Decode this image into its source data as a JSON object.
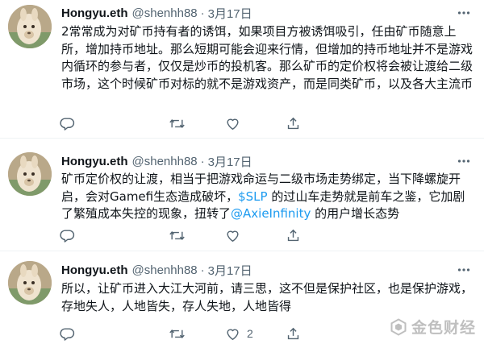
{
  "colors": {
    "accent": "#1d9bf0",
    "muted": "#536471",
    "text": "#0f1419",
    "watermark": "#b5b5b5"
  },
  "tweets": [
    {
      "author_name": "Hongyu.eth",
      "author_handle": "@shenhh88",
      "separator": "·",
      "date": "3月17日",
      "text_segments": [
        {
          "text": "2常常成为对矿币持有者的诱饵，如果项目方被诱饵吸引，任由矿币随意上所，增加持币地址。那么短期可能会迎来行情，但增加的持币地址并不是游戏内循环的参与者，仅仅是炒币的投机客。那么矿币的定价权将会被让渡给二级市场，这个时候矿币对标的就不是游戏资产，而是同类矿币，以及各大主流币"
        }
      ],
      "replies": "",
      "retweets": "",
      "likes": "",
      "icons": [
        "reply-icon",
        "retweet-icon",
        "like-icon",
        "share-icon",
        "more-icon"
      ]
    },
    {
      "author_name": "Hongyu.eth",
      "author_handle": "@shenhh88",
      "separator": "·",
      "date": "3月17日",
      "text_segments": [
        {
          "text": "矿币定价权的让渡，相当于把游戏命运与二级市场走势绑定，当下降螺旋开启，会对Gamefi生态造成破坏，"
        },
        {
          "text": "$SLP",
          "type": "cashtag"
        },
        {
          "text": " 的过山车走势就是前车之鉴，它加剧了繁殖成本失控的现象，扭转了"
        },
        {
          "text": "@AxieInfinity",
          "type": "mention"
        },
        {
          "text": " 的用户增长态势"
        }
      ],
      "replies": "",
      "retweets": "",
      "likes": "",
      "icons": [
        "reply-icon",
        "retweet-icon",
        "like-icon",
        "share-icon",
        "more-icon"
      ]
    },
    {
      "author_name": "Hongyu.eth",
      "author_handle": "@shenhh88",
      "separator": "·",
      "date": "3月17日",
      "text_segments": [
        {
          "text": "所以，让矿币进入大江大河前，请三思，这不但是保护社区，也是保护游戏，存地失人，人地皆失，存人失地，人地皆得"
        }
      ],
      "replies": "",
      "retweets": "",
      "likes": "2",
      "icons": [
        "reply-icon",
        "retweet-icon",
        "like-icon",
        "share-icon",
        "more-icon"
      ]
    }
  ],
  "watermark": {
    "text": "金色财经",
    "icon": "jinse-logo-icon"
  }
}
